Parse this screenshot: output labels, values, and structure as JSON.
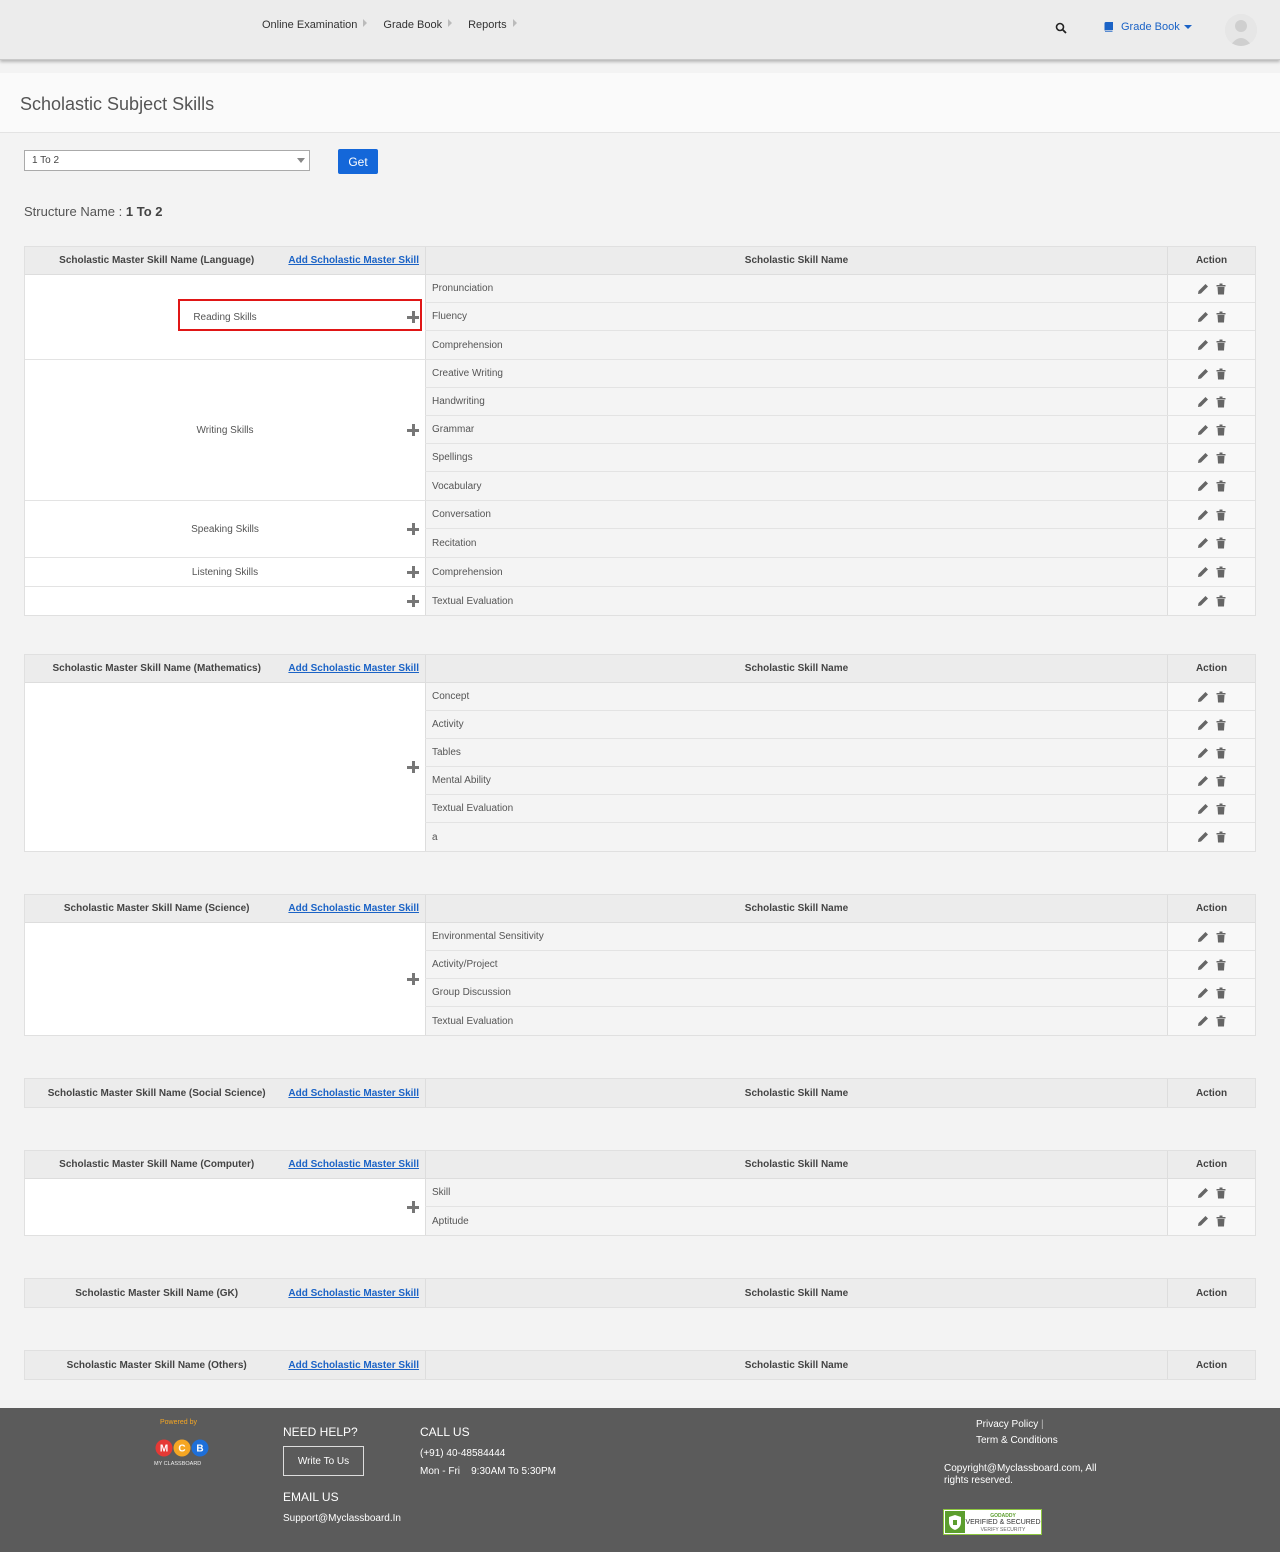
{
  "header": {
    "nav": [
      "Online Examination",
      "Grade Book",
      "Reports"
    ],
    "gradebook_menu": "Grade Book",
    "search_icon": "search-icon",
    "avatar_icon": "user-avatar"
  },
  "page": {
    "title": "Scholastic Subject Skills",
    "select_value": "1 To 2",
    "get_label": "Get",
    "structure_label": "Structure Name : ",
    "structure_value": "1 To 2"
  },
  "table_common": {
    "add_link": "Add Scholastic Master Skill",
    "skill_col": "Scholastic Skill Name",
    "action_col": "Action"
  },
  "tables": {
    "language": {
      "master_header": "Scholastic Master Skill Name (Language)",
      "groups": [
        {
          "name": "Reading Skills",
          "skills": [
            "Pronunciation",
            "Fluency",
            "Comprehension"
          ]
        },
        {
          "name": "Writing Skills",
          "skills": [
            "Creative Writing",
            "Handwriting",
            "Grammar",
            "Spellings",
            "Vocabulary"
          ]
        },
        {
          "name": "Speaking Skills",
          "skills": [
            "Conversation",
            "Recitation"
          ]
        },
        {
          "name": "Listening Skills",
          "skills": [
            "Comprehension"
          ]
        },
        {
          "name": "",
          "skills": [
            "Textual Evaluation"
          ]
        }
      ]
    },
    "mathematics": {
      "master_header": "Scholastic Master Skill Name (Mathematics)",
      "groups": [
        {
          "name": "",
          "skills": [
            "Concept",
            "Activity",
            "Tables",
            "Mental Ability",
            "Textual Evaluation",
            "a"
          ]
        }
      ]
    },
    "science": {
      "master_header": "Scholastic Master Skill Name (Science)",
      "groups": [
        {
          "name": "",
          "skills": [
            "Environmental Sensitivity",
            "Activity/Project",
            "Group Discussion",
            "Textual Evaluation"
          ]
        }
      ]
    },
    "social_science": {
      "master_header": "Scholastic Master Skill Name (Social Science)",
      "groups": []
    },
    "computer": {
      "master_header": "Scholastic Master Skill Name (Computer)",
      "groups": [
        {
          "name": "",
          "skills": [
            "Skill",
            "Aptitude"
          ]
        }
      ]
    },
    "gk": {
      "master_header": "Scholastic Master Skill Name (GK)",
      "groups": []
    },
    "others": {
      "master_header": "Scholastic Master Skill Name (Others)",
      "groups": []
    }
  },
  "footer": {
    "powered_by": "Powered by",
    "logo_letters": [
      "M",
      "C",
      "B"
    ],
    "logo_caption": "MY CLASSBOARD",
    "need_help": "NEED HELP?",
    "write_to_us": "Write To Us",
    "email_us": "EMAIL US",
    "email": "Support@Myclassboard.In",
    "call_us": "CALL US",
    "phone": "(+91) 40-48584444",
    "hours": "Mon - Fri    9:30AM To 5:30PM",
    "privacy": "Privacy Policy",
    "terms": "Term & Conditions",
    "copyright": "Copyright@Myclassboard.com, All rights reserved.",
    "seal_brand": "GODADDY",
    "seal_line1": "VERIFIED & SECURED",
    "seal_line2": "VERIFY SECURITY"
  },
  "colors": {
    "accent": "#1467d9",
    "link": "#1b63c6",
    "highlight": "#e01616",
    "footer_bg": "#5b5b5b",
    "logo_red": "#e53935",
    "logo_yellow": "#f5a623",
    "logo_blue": "#1e6fd9"
  }
}
